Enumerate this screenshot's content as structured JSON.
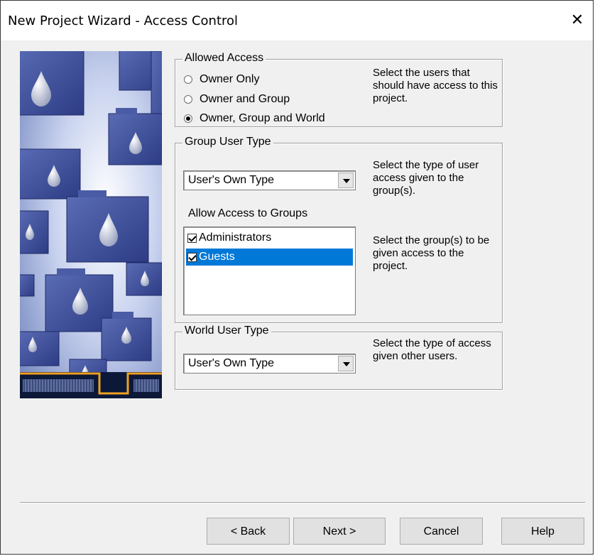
{
  "window": {
    "title": "New Project Wizard - Access Control",
    "close_glyph": "✕"
  },
  "allowed_access": {
    "legend": "Allowed Access",
    "options": [
      {
        "label": "Owner Only",
        "selected": false
      },
      {
        "label": "Owner and Group",
        "selected": false
      },
      {
        "label": "Owner, Group and World",
        "selected": true
      }
    ],
    "help": "Select the users that should have access to this project."
  },
  "group_user_type": {
    "legend": "Group User Type",
    "combo_value": "User's Own Type",
    "combo_help": "Select the type of user access given to the group(s).",
    "groups_label": "Allow Access to Groups",
    "groups": [
      {
        "label": "Administrators",
        "checked": true,
        "selected": false
      },
      {
        "label": "Guests",
        "checked": true,
        "selected": true
      }
    ],
    "groups_help": "Select the group(s) to be given access to the project."
  },
  "world_user_type": {
    "legend": "World User Type",
    "combo_value": "User's Own Type",
    "help": "Select the type of access given other users."
  },
  "buttons": {
    "back": "< Back",
    "next": "Next >",
    "cancel": "Cancel",
    "help": "Help"
  },
  "colors": {
    "selection": "#0078d7",
    "art_background": "#7b8fc7",
    "folder": "#3d4f9a",
    "accent": "#f0a020"
  }
}
